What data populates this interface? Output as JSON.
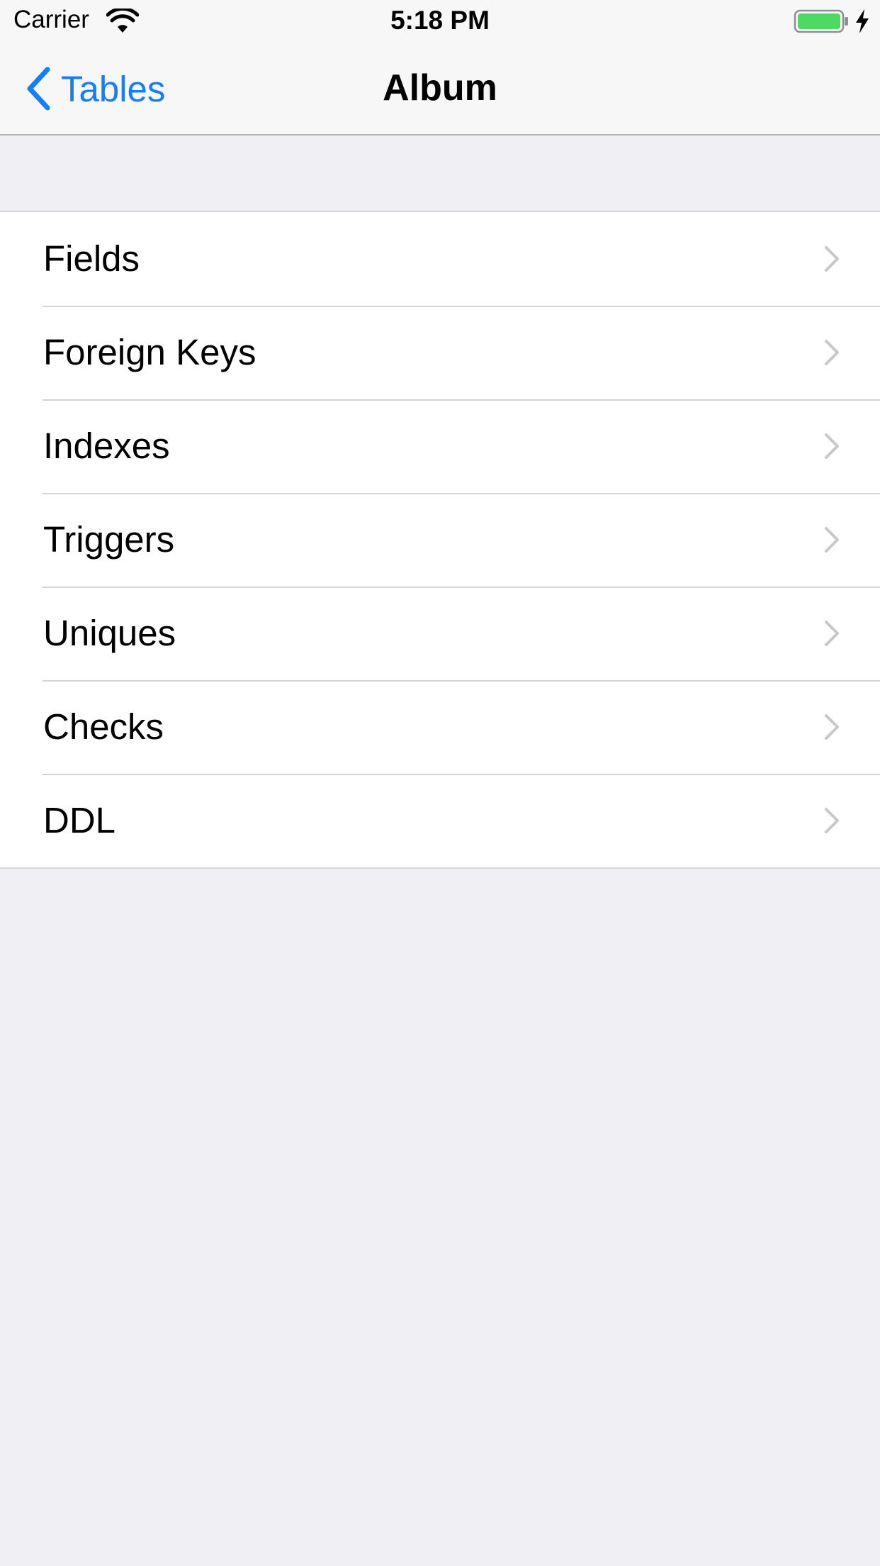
{
  "status_bar": {
    "carrier": "Carrier",
    "time": "5:18 PM",
    "icons": [
      "wifi-icon",
      "battery-icon",
      "charging-bolt-icon"
    ]
  },
  "nav": {
    "back_label": "Tables",
    "title": "Album"
  },
  "menu": {
    "items": [
      {
        "label": "Fields"
      },
      {
        "label": "Foreign Keys"
      },
      {
        "label": "Indexes"
      },
      {
        "label": "Triggers"
      },
      {
        "label": "Uniques"
      },
      {
        "label": "Checks"
      },
      {
        "label": "DDL"
      }
    ]
  },
  "colors": {
    "accent": "#147efb",
    "battery_fill": "#4cd964",
    "background": "#efeff4",
    "chevron": "#c7c7cc"
  }
}
